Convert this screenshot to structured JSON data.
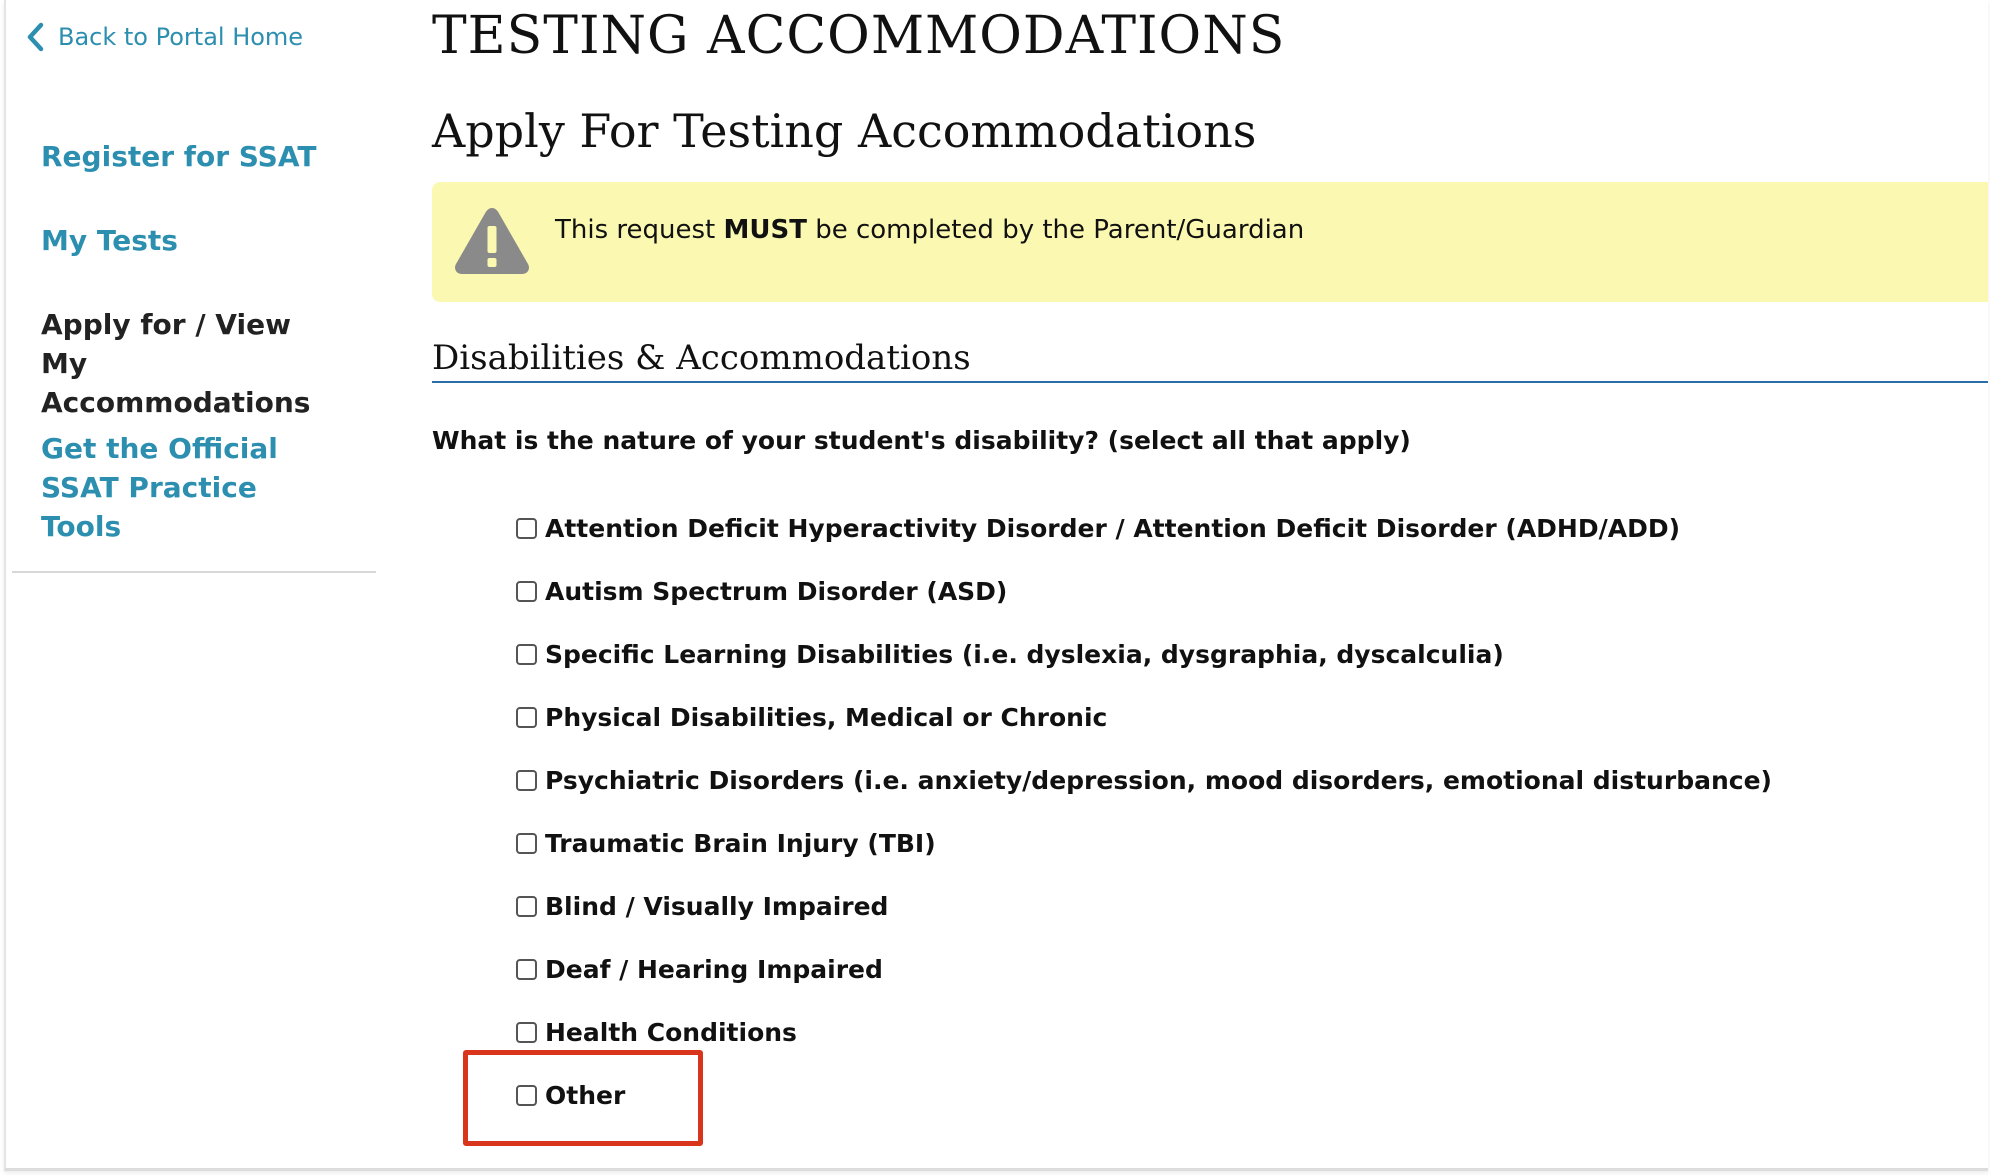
{
  "sidebar": {
    "back_link": "Back to Portal Home",
    "items": [
      {
        "label": "Register for SSAT"
      },
      {
        "label": "My Tests"
      },
      {
        "label": "Apply for / View My Accommodations"
      },
      {
        "label": "Get the Official SSAT Practice Tools"
      }
    ]
  },
  "main": {
    "title": "TESTING ACCOMMODATIONS",
    "subtitle": "Apply For Testing Accommodations",
    "alert": {
      "icon": "warning-icon",
      "text_before": "This request ",
      "text_bold": "MUST",
      "text_after": " be completed by the Parent/Guardian"
    },
    "section_heading": "Disabilities & Accommodations",
    "question": "What is the nature of your student's disability? (select all that apply)",
    "options": [
      {
        "label": "Attention Deficit Hyperactivity Disorder / Attention Deficit Disorder (ADHD/ADD)",
        "checked": false
      },
      {
        "label": "Autism Spectrum Disorder (ASD)",
        "checked": false
      },
      {
        "label": "Specific Learning Disabilities (i.e. dyslexia, dysgraphia, dyscalculia)",
        "checked": false
      },
      {
        "label": "Physical Disabilities, Medical or Chronic",
        "checked": false
      },
      {
        "label": "Psychiatric Disorders (i.e. anxiety/depression, mood disorders, emotional disturbance)",
        "checked": false
      },
      {
        "label": "Traumatic Brain Injury (TBI)",
        "checked": false
      },
      {
        "label": "Blind / Visually Impaired",
        "checked": false
      },
      {
        "label": "Deaf / Hearing Impaired",
        "checked": false
      },
      {
        "label": "Health Conditions",
        "checked": false
      },
      {
        "label": "Other",
        "checked": false
      }
    ]
  },
  "colors": {
    "link": "#2d8fb0",
    "alert_bg": "#fbf9b1",
    "rule": "#2a6ea5",
    "highlight": "#d9341c"
  }
}
